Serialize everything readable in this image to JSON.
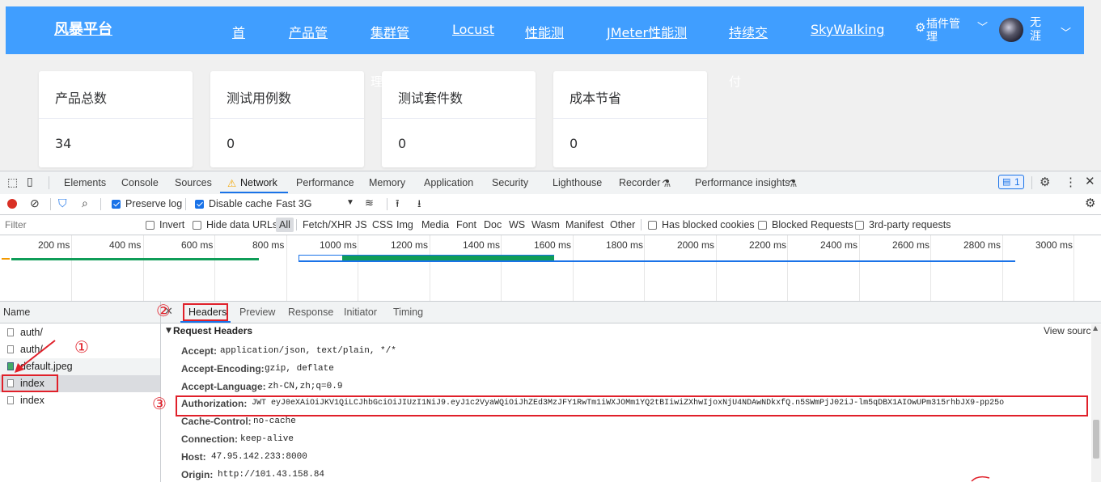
{
  "app": {
    "brand": "风暴平台",
    "nav": [
      "首",
      "产品管",
      "集群管",
      "Locust",
      "性能测",
      "JMeter性能测",
      "持续交",
      "SkyWalking"
    ],
    "nav_overflow": [
      "理",
      "付"
    ],
    "plugin_menu": "插件管理",
    "user": "无涯",
    "cards": [
      {
        "title": "产品总数",
        "value": "34"
      },
      {
        "title": "测试用例数",
        "value": "0"
      },
      {
        "title": "测试套件数",
        "value": "0"
      },
      {
        "title": "成本节省",
        "value": "0"
      }
    ]
  },
  "devtools": {
    "tabs": [
      "Elements",
      "Console",
      "Sources",
      "Network",
      "Performance",
      "Memory",
      "Application",
      "Security",
      "Lighthouse",
      "Recorder",
      "Performance insights"
    ],
    "active_tab": "Network",
    "issues_count": "1",
    "toolbar": {
      "preserve_log": "Preserve log",
      "disable_cache": "Disable cache",
      "throttling": "Fast 3G"
    },
    "filter": {
      "placeholder": "Filter",
      "invert": "Invert",
      "hide_data_urls": "Hide data URLs",
      "types": [
        "All",
        "Fetch/XHR",
        "JS",
        "CSS",
        "Img",
        "Media",
        "Font",
        "Doc",
        "WS",
        "Wasm",
        "Manifest",
        "Other"
      ],
      "has_blocked_cookies": "Has blocked cookies",
      "blocked_requests": "Blocked Requests",
      "third_party": "3rd-party requests"
    },
    "timeline_ticks": [
      "200 ms",
      "400 ms",
      "600 ms",
      "800 ms",
      "1000 ms",
      "1200 ms",
      "1400 ms",
      "1600 ms",
      "1800 ms",
      "2000 ms",
      "2200 ms",
      "2400 ms",
      "2600 ms",
      "2800 ms",
      "3000 ms"
    ],
    "requests": {
      "header": "Name",
      "items": [
        "auth/",
        "auth/",
        "default.jpeg",
        "index",
        "index"
      ]
    },
    "detail_tabs": [
      "Headers",
      "Preview",
      "Response",
      "Initiator",
      "Timing"
    ],
    "section_title": "Request Headers",
    "view_source": "View source",
    "headers": [
      {
        "name": "Accept:",
        "value": "application/json, text/plain, */*"
      },
      {
        "name": "Accept-Encoding:",
        "value": "gzip, deflate"
      },
      {
        "name": "Accept-Language:",
        "value": "zh-CN,zh;q=0.9"
      },
      {
        "name": "Authorization:",
        "value": "JWT eyJ0eXAiOiJKV1QiLCJhbGciOiJIUzI1NiJ9.eyJ1c2VyaWQiOiJhZEd3MzJFY1RwTm1iWXJOMm1YQ2tBIiwiZXhwIjoxNjU4NDAwNDkxfQ.n5SWmPjJ02iJ-lm5qDBX1AIOwUPm315rhbJX9-pp25o"
      },
      {
        "name": "Cache-Control:",
        "value": "no-cache"
      },
      {
        "name": "Connection:",
        "value": "keep-alive"
      },
      {
        "name": "Host:",
        "value": "47.95.142.233:8000"
      },
      {
        "name": "Origin:",
        "value": "http://101.43.158.84"
      }
    ],
    "annotations": [
      "①",
      "②",
      "③"
    ],
    "colors": {
      "nav_bg": "#409eff",
      "annotation_red": "#e0202a",
      "devtools_blue": "#1a73e8"
    }
  }
}
